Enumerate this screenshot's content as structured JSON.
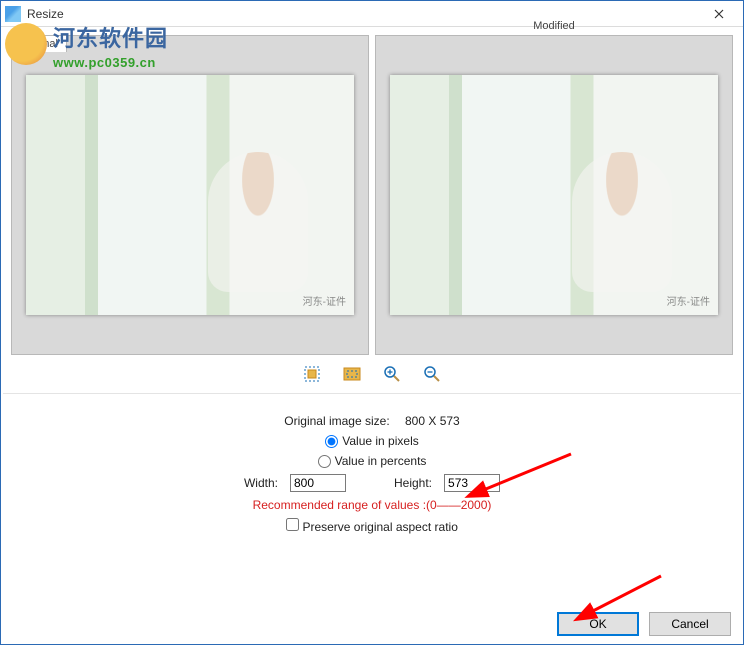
{
  "window": {
    "title": "Resize"
  },
  "watermark": {
    "cn": "河东软件园",
    "url": "www.pc0359.cn"
  },
  "previews": {
    "original_label": "Original",
    "modified_label": "Modified",
    "image_caption": "河东-证件"
  },
  "toolbar": {
    "fit_icon": "fit-window-icon",
    "actual_icon": "actual-size-icon",
    "zoom_in_icon": "zoom-in-icon",
    "zoom_out_icon": "zoom-out-icon"
  },
  "form": {
    "original_size_label": "Original image size:",
    "original_size_value": "800 X 573",
    "radio_pixels": "Value in pixels",
    "radio_percents": "Value in percents",
    "width_label": "Width:",
    "width_value": "800",
    "height_label": "Height:",
    "height_value": "573",
    "recommended": "Recommended range of values :(0——2000)",
    "preserve_label": "Preserve original aspect ratio",
    "pixels_checked": true,
    "percents_checked": false,
    "preserve_checked": false
  },
  "buttons": {
    "ok": "OK",
    "cancel": "Cancel"
  },
  "colors": {
    "accent": "#0078d7",
    "warning": "#d61f1f"
  }
}
